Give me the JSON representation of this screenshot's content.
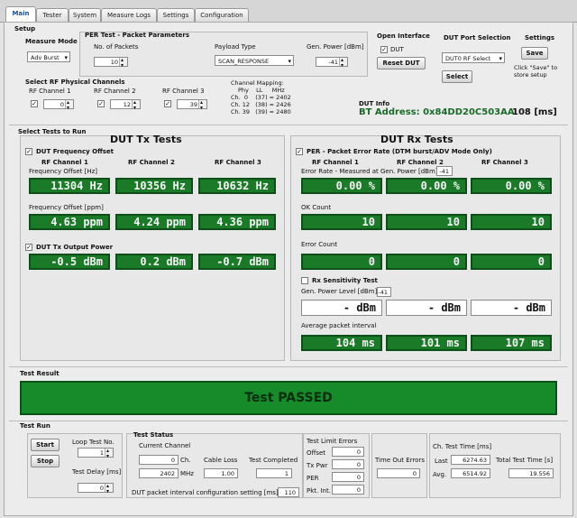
{
  "tabs": [
    "Main",
    "Tester",
    "System",
    "Measure Logs",
    "Settings",
    "Configuration"
  ],
  "setup": {
    "title": "Setup",
    "measure_mode_label": "Measure Mode",
    "measure_mode_value": "Adv Burst",
    "per_title": "PER Test - Packet Parameters",
    "num_packets_label": "No. of Packets",
    "num_packets_value": "10",
    "payload_label": "Payload Type",
    "payload_value": "SCAN_RESPONSE",
    "gen_power_label": "Gen. Power [dBm]",
    "gen_power_value": "-41",
    "open_interface_title": "Open Interface",
    "dut_checkbox_label": "DUT",
    "reset_dut_label": "Reset DUT",
    "port_title": "DUT Port Selection",
    "port_value": "DUT0 RF Select",
    "select_label": "Select",
    "settings_title": "Settings",
    "save_label": "Save",
    "save_hint": "Click \"Save\" to store setup",
    "rf_title": "Select RF Physical Channels",
    "rf1_label": "RF Channel 1",
    "rf1_value": "0",
    "rf2_label": "RF Channel 2",
    "rf2_value": "12",
    "rf3_label": "RF Channel 3",
    "rf3_value": "39",
    "mapping_title": "Channel Mapping:",
    "mapping_header": "Phy    LL     MHz",
    "mapping_rows": [
      "Ch.  0    (37) = 2402",
      "Ch. 12   (38) = 2426",
      "Ch. 39   (39) = 2480"
    ],
    "dut_info_label": "DUT Info",
    "bt_address": "BT Address: 0x84DD20C503AA",
    "bt_time": "108 [ms]"
  },
  "tests": {
    "select_title": "Select Tests to Run",
    "tx_title": "DUT Tx Tests",
    "rx_title": "DUT Rx Tests",
    "freq_offset_check": "DUT Frequency Offset",
    "ch1": "RF Channel 1",
    "ch2": "RF Channel 2",
    "ch3": "RF Channel 3",
    "freq_offset_hz_label": "Frequency Offset [Hz]",
    "freq_hz": [
      "11304 Hz",
      "10356 Hz",
      "10632 Hz"
    ],
    "freq_ppm_label": "Frequency Offset [ppm]",
    "freq_ppm": [
      "4.63 ppm",
      "4.24 ppm",
      "4.36 ppm"
    ],
    "tx_power_check": "DUT Tx Output Power",
    "tx_power": [
      "-0.5 dBm",
      "0.2 dBm",
      "-0.7 dBm"
    ],
    "per_check": "PER - Packet Error Rate (DTM burst/ADV Mode Only)",
    "error_rate_label": "Error Rate - Measured at Gen. Power [dBm]",
    "error_rate_power": "-41",
    "error_rate": [
      "0.00 %",
      "0.00 %",
      "0.00 %"
    ],
    "ok_count_label": "OK Count",
    "ok_count": [
      "10",
      "10",
      "10"
    ],
    "error_count_label": "Error Count",
    "error_count": [
      "0",
      "0",
      "0"
    ],
    "rx_sens_check": "Rx Sensitivity Test",
    "gen_power_level_label": "Gen. Power Level [dBm]",
    "gen_power_level_value": "-41",
    "sens": [
      "- dBm",
      "- dBm",
      "- dBm"
    ],
    "avg_interval_label": "Average packet interval",
    "avg_interval": [
      "104 ms",
      "101 ms",
      "107 ms"
    ]
  },
  "result": {
    "title": "Test Result",
    "text": "Test PASSED",
    "color": "#178a2a"
  },
  "run": {
    "title": "Test Run",
    "start_label": "Start",
    "stop_label": "Stop",
    "loop_label": "Loop Test No.",
    "loop_value": "1",
    "delay_label": "Test Delay [ms]",
    "delay_value": "0",
    "status_title": "Test Status",
    "current_channel_label": "Current Channel",
    "channel_value": "0",
    "channel_unit": "Ch.",
    "mhz_value": "2402",
    "mhz_unit": "MHz",
    "cable_loss_label": "Cable Loss",
    "cable_loss_value": "1.00",
    "test_completed_label": "Test Completed",
    "test_completed_value": "1",
    "interval_cfg_label": "DUT packet interval configuration setting [ms]",
    "interval_cfg_value": "110",
    "limit_title": "Test Limit Errors",
    "offset_label": "Offset",
    "offset_value": "0",
    "txpwr_label": "Tx Pwr",
    "txpwr_value": "0",
    "per_label": "PER",
    "per_value": "0",
    "pkt_label": "Pkt. Int.",
    "pkt_value": "0",
    "timeout_label": "Time Out Errors",
    "timeout_value": "0",
    "ch_time_label": "Ch. Test Time [ms]",
    "last_label": "Last",
    "last_value": "6274.63",
    "avg_label": "Avg.",
    "avg_value": "6514.92",
    "total_label": "Total Test Time [s]",
    "total_value": "19.556"
  }
}
